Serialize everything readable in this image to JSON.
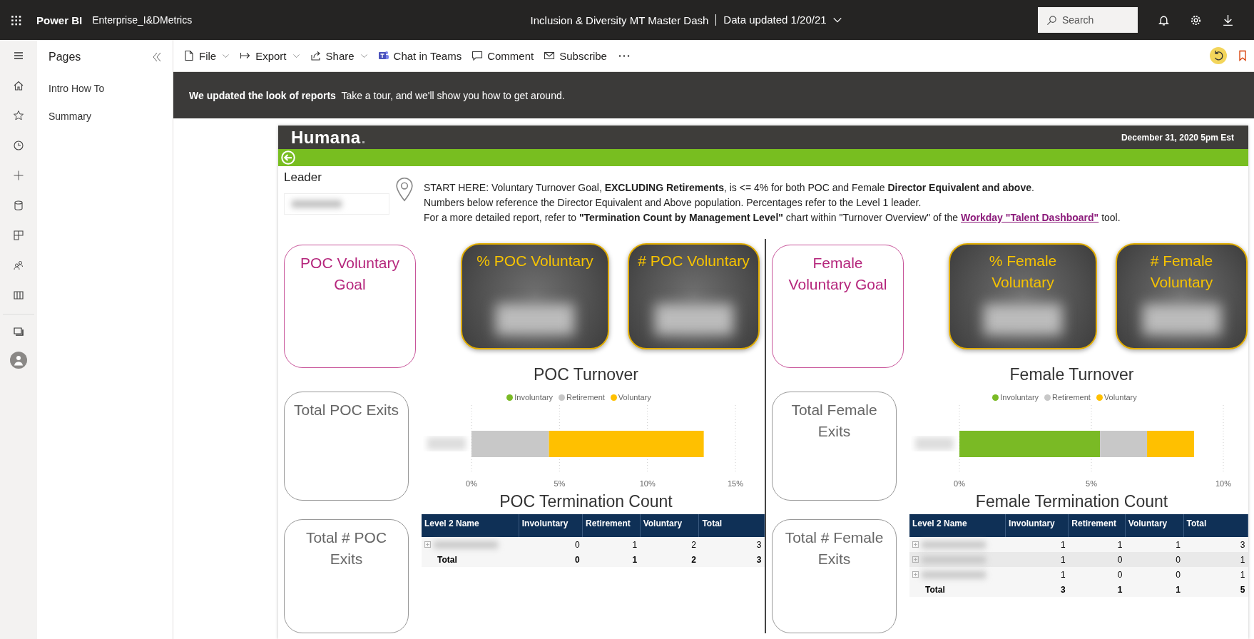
{
  "app": {
    "name": "Power BI",
    "workspace": "Enterprise_I&DMetrics",
    "report_title": "Inclusion & Diversity MT Master Dash",
    "data_updated": "Data updated 1/20/21",
    "search": {
      "placeholder": "Search"
    }
  },
  "toolbar": [
    {
      "kind": "file",
      "label": "File",
      "dropdown": true
    },
    {
      "kind": "export",
      "label": "Export",
      "dropdown": true
    },
    {
      "kind": "share",
      "label": "Share",
      "dropdown": true
    },
    {
      "kind": "teams",
      "label": "Chat in Teams",
      "dropdown": false
    },
    {
      "kind": "comment",
      "label": "Comment",
      "dropdown": false
    },
    {
      "kind": "subscribe",
      "label": "Subscribe",
      "dropdown": false
    }
  ],
  "pages": {
    "title": "Pages",
    "items": [
      {
        "label": "Intro How To",
        "selected": false
      },
      {
        "label": "Summary",
        "selected": false
      }
    ]
  },
  "banner": {
    "message": "**We updated the look of reports**  Take a tour, and we'll show you how to get around."
  },
  "report": {
    "logo": "Humana",
    "date": "December 31, 2020 5pm Est",
    "slicer": {
      "label": "Leader"
    },
    "notes": {
      "lines": [
        "START HERE: Voluntary Turnover Goal, **EXCLUDING Retirements**, is <= 4% for both POC and Female **Director Equivalent and above**.",
        "Numbers below reference the Director Equivalent and Above population. Percentages refer to the Level 1 leader."
      ],
      "last_line": {
        "before": "For a more detailed report, refer to  **\"Termination Count by Management Level\"** chart within \"Turnover Overview\" of the",
        "link": "Workday \"Talent Dashboard\"",
        "after": " tool."
      }
    },
    "sections": [
      {
        "goal_card": {
          "title": "POC Voluntary Goal"
        },
        "kpi_cards": [
          {
            "title": "% POC Voluntary"
          },
          {
            "title": "# POC Voluntary"
          }
        ],
        "chart": {
          "chart_data": {
            "type": "bar",
            "orientation": "horizontal",
            "stacked": true,
            "title": "POC Turnover",
            "xlim": [
              0,
              15
            ],
            "xticks": [
              {
                "value": 0,
                "label": "0%"
              },
              {
                "value": 5,
                "label": "5%"
              },
              {
                "value": 10,
                "label": "10%"
              },
              {
                "value": 15,
                "label": "15%"
              }
            ],
            "series": [
              {
                "name": "Involuntary",
                "color": "#7aba25",
                "values": [
                  0
                ]
              },
              {
                "name": "Retirement",
                "color": "#c8c8c8",
                "values": [
                  4.4
                ]
              },
              {
                "name": "Voluntary",
                "color": "#ffc000",
                "values": [
                  8.8
                ]
              }
            ]
          }
        },
        "exit_cards": [
          {
            "title": "Total POC Exits"
          },
          {
            "title": "Total # POC Exits"
          }
        ],
        "table": {
          "title": "POC Termination Count",
          "columns": [
            "Level 2 Name",
            "Involuntary",
            "Retirement",
            "Voluntary",
            "Total"
          ],
          "rows": [
            {
              "kind": "data",
              "values": [
                "0",
                "1",
                "2",
                "3"
              ]
            },
            {
              "kind": "total",
              "label": "Total",
              "values": [
                "0",
                "1",
                "2",
                "3"
              ]
            }
          ]
        }
      },
      {
        "goal_card": {
          "title": "Female Voluntary Goal"
        },
        "kpi_cards": [
          {
            "title": "% Female Voluntary"
          },
          {
            "title": "# Female Voluntary"
          }
        ],
        "chart": {
          "chart_data": {
            "type": "bar",
            "orientation": "horizontal",
            "stacked": true,
            "title": "Female Turnover",
            "xlim": [
              0,
              10
            ],
            "xticks": [
              {
                "value": 0,
                "label": "0%"
              },
              {
                "value": 5,
                "label": "5%"
              },
              {
                "value": 10,
                "label": "10%"
              }
            ],
            "series": [
              {
                "name": "Involuntary",
                "color": "#7aba25",
                "values": [
                  5.33
                ]
              },
              {
                "name": "Retirement",
                "color": "#c8c8c8",
                "values": [
                  1.78
                ]
              },
              {
                "name": "Voluntary",
                "color": "#ffc000",
                "values": [
                  1.78
                ]
              }
            ]
          }
        },
        "exit_cards": [
          {
            "title": "Total Female Exits"
          },
          {
            "title": "Total # Female Exits"
          }
        ],
        "table": {
          "title": "Female Termination Count",
          "columns": [
            "Level 2 Name",
            "Involuntary",
            "Retirement",
            "Voluntary",
            "Total"
          ],
          "rows": [
            {
              "kind": "data",
              "values": [
                "1",
                "1",
                "1",
                "3"
              ]
            },
            {
              "kind": "data",
              "values": [
                "1",
                "0",
                "0",
                "1"
              ]
            },
            {
              "kind": "data",
              "values": [
                "1",
                "0",
                "0",
                "1"
              ]
            },
            {
              "kind": "total",
              "label": "Total",
              "values": [
                "3",
                "1",
                "1",
                "5"
              ]
            }
          ]
        }
      }
    ]
  }
}
